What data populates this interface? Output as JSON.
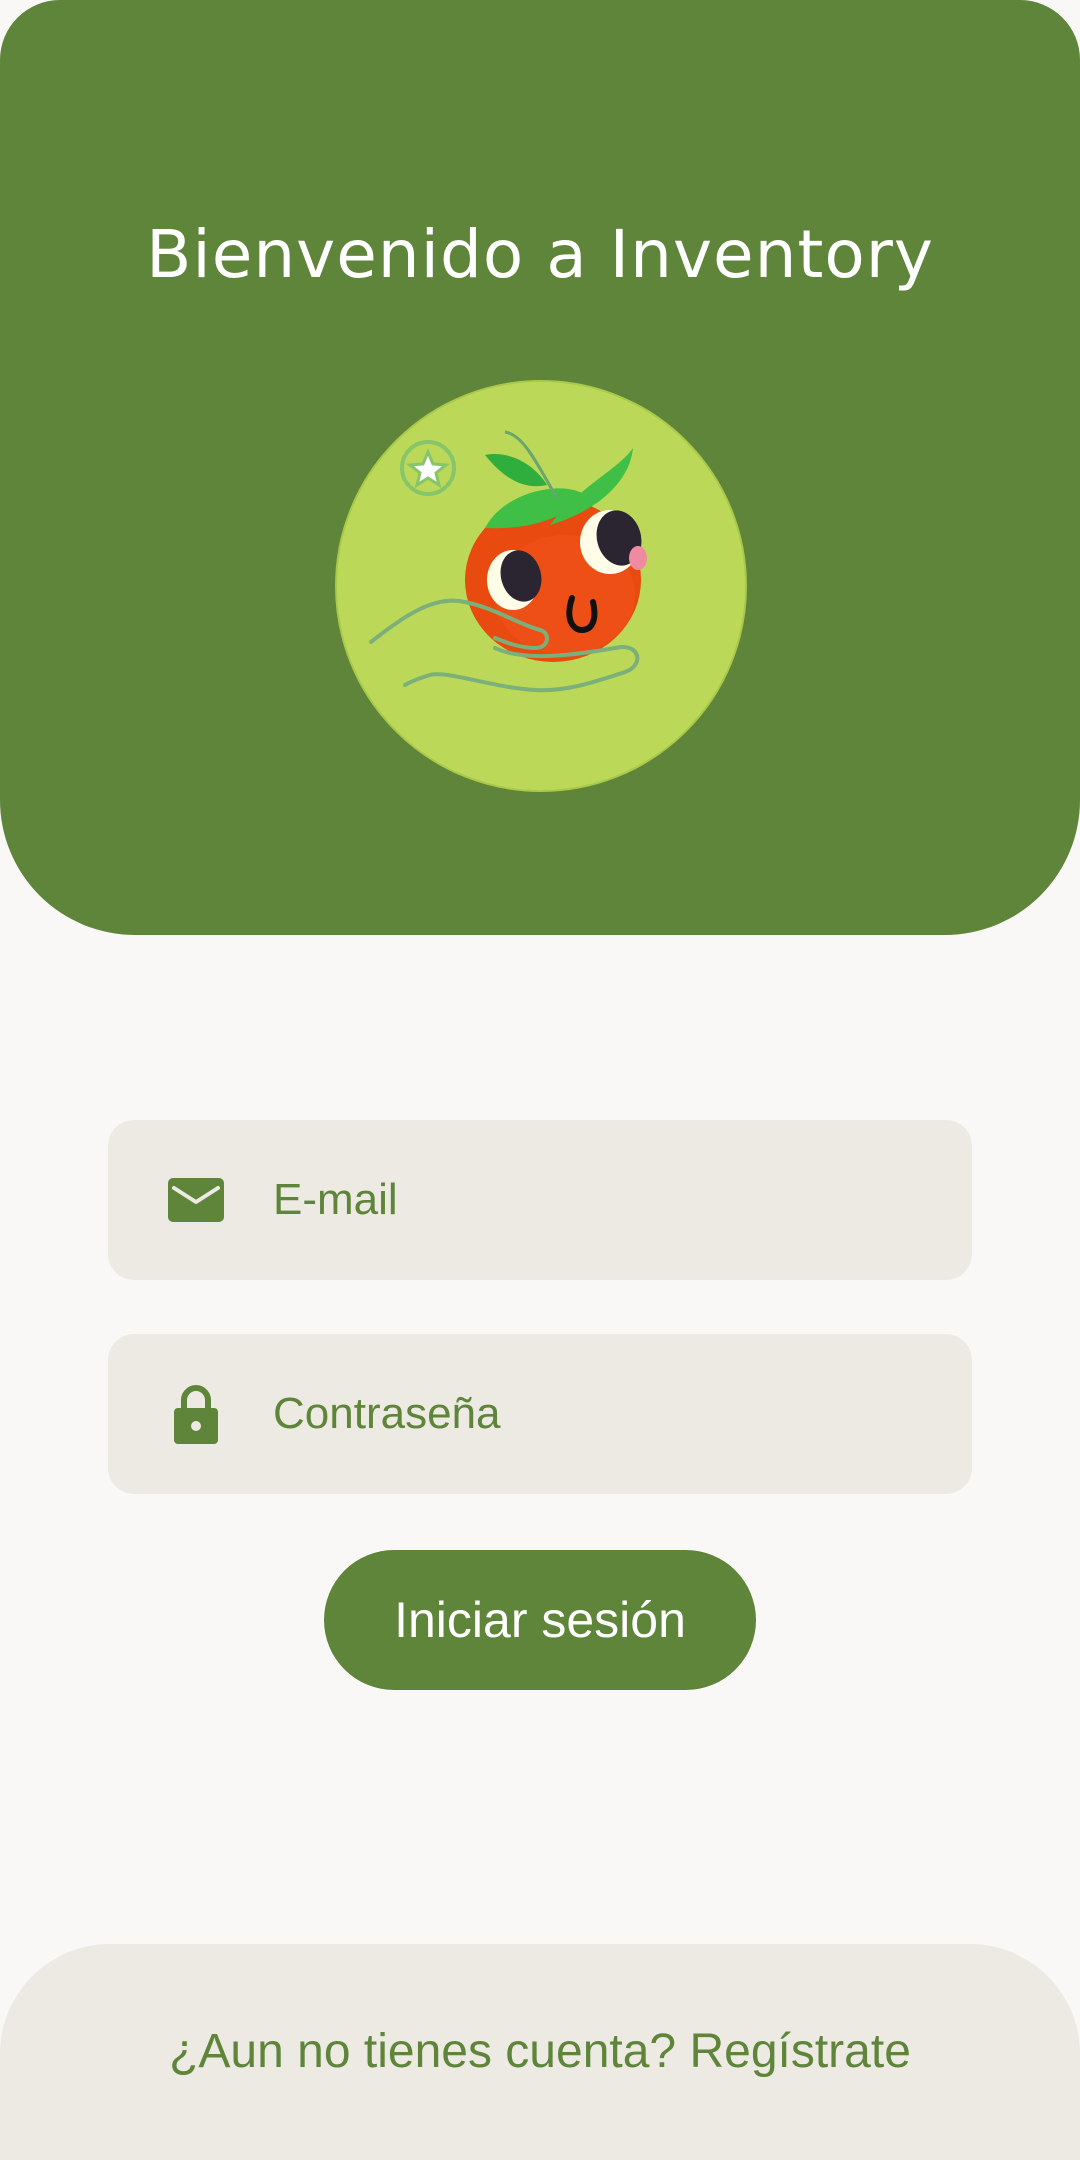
{
  "header": {
    "title": "Bienvenido a Inventory",
    "logo_icon": "tomato-hand-logo-icon"
  },
  "form": {
    "email": {
      "placeholder": "E-mail",
      "value": "",
      "icon": "mail-icon"
    },
    "password": {
      "placeholder": "Contraseña",
      "value": "",
      "icon": "lock-icon"
    },
    "submit_label": "Iniciar sesión"
  },
  "footer": {
    "register_label": "¿Aun no tienes cuenta? Regístrate"
  },
  "colors": {
    "primary": "#5e8539",
    "field_bg": "#edeae4",
    "page_bg": "#f9f8f7",
    "logo_bg": "#bcd858",
    "tomato": "#e84a10"
  }
}
